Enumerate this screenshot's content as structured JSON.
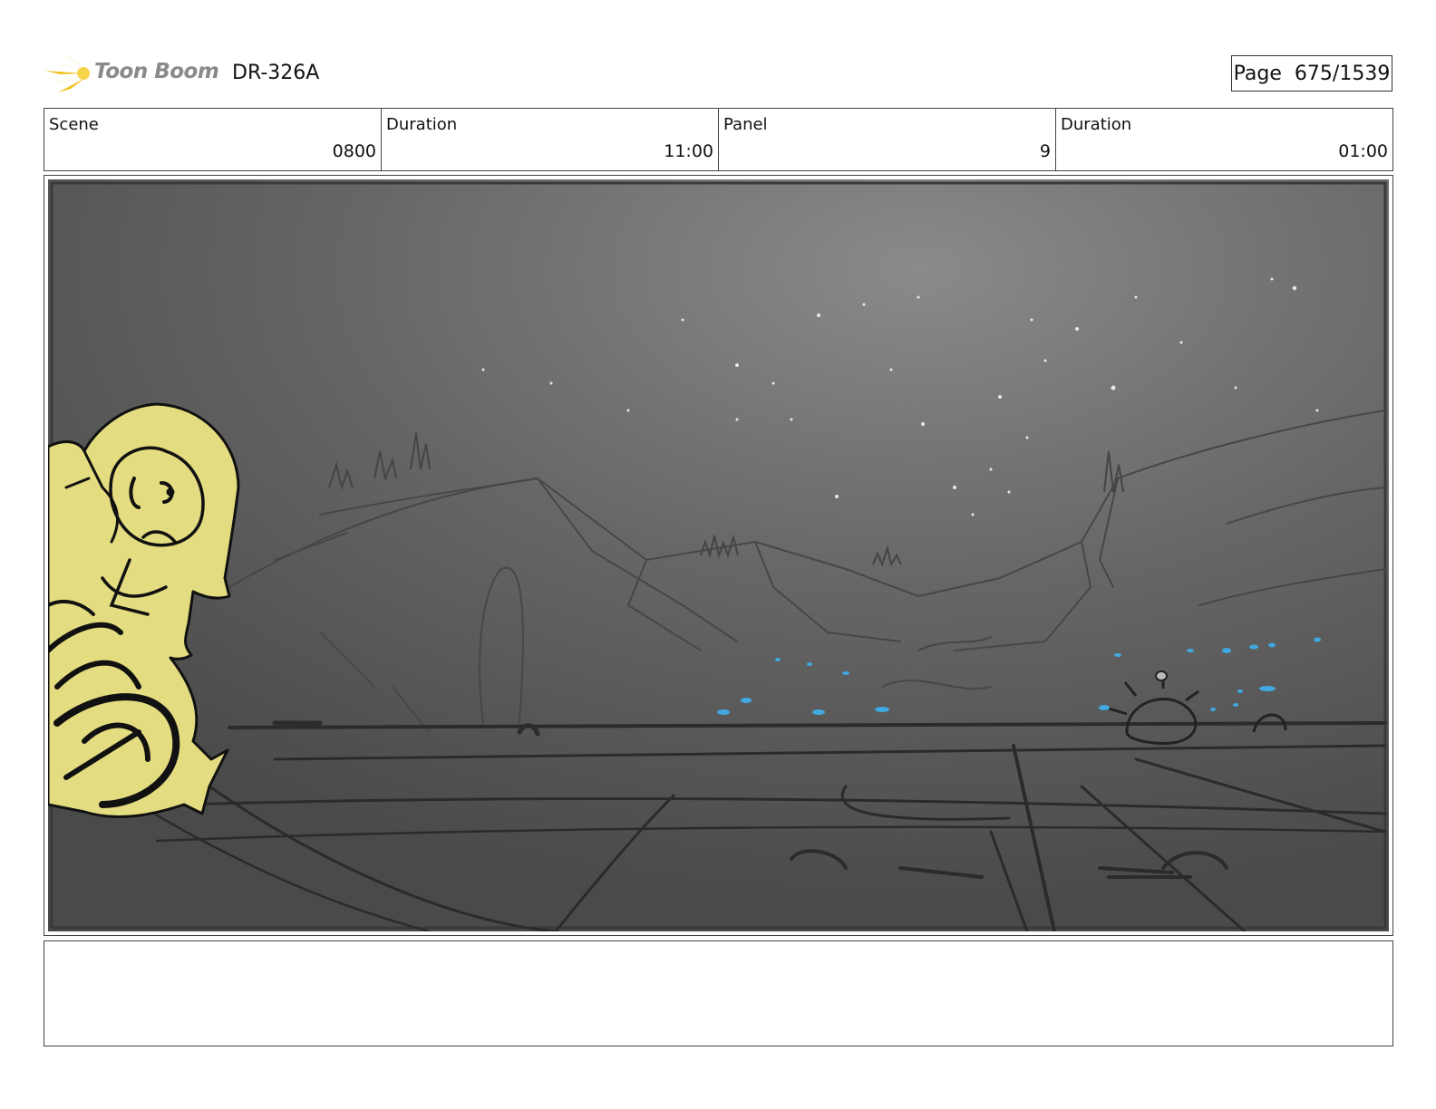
{
  "header": {
    "logo_text": "Toon Boom",
    "doc_id": "DR-326A",
    "page_label": "Page",
    "page_value": "675/1539"
  },
  "info": [
    {
      "label": "Scene",
      "value": "0800"
    },
    {
      "label": "Duration",
      "value": "11:00"
    },
    {
      "label": "Panel",
      "value": "9"
    },
    {
      "label": "Duration",
      "value": "01:00"
    }
  ],
  "panel": {
    "description": "",
    "colors": {
      "sky": "#5e5e5e",
      "character": "#e3dc80",
      "water_glint": "#3fa9e0"
    }
  },
  "notes": {
    "text": ""
  }
}
